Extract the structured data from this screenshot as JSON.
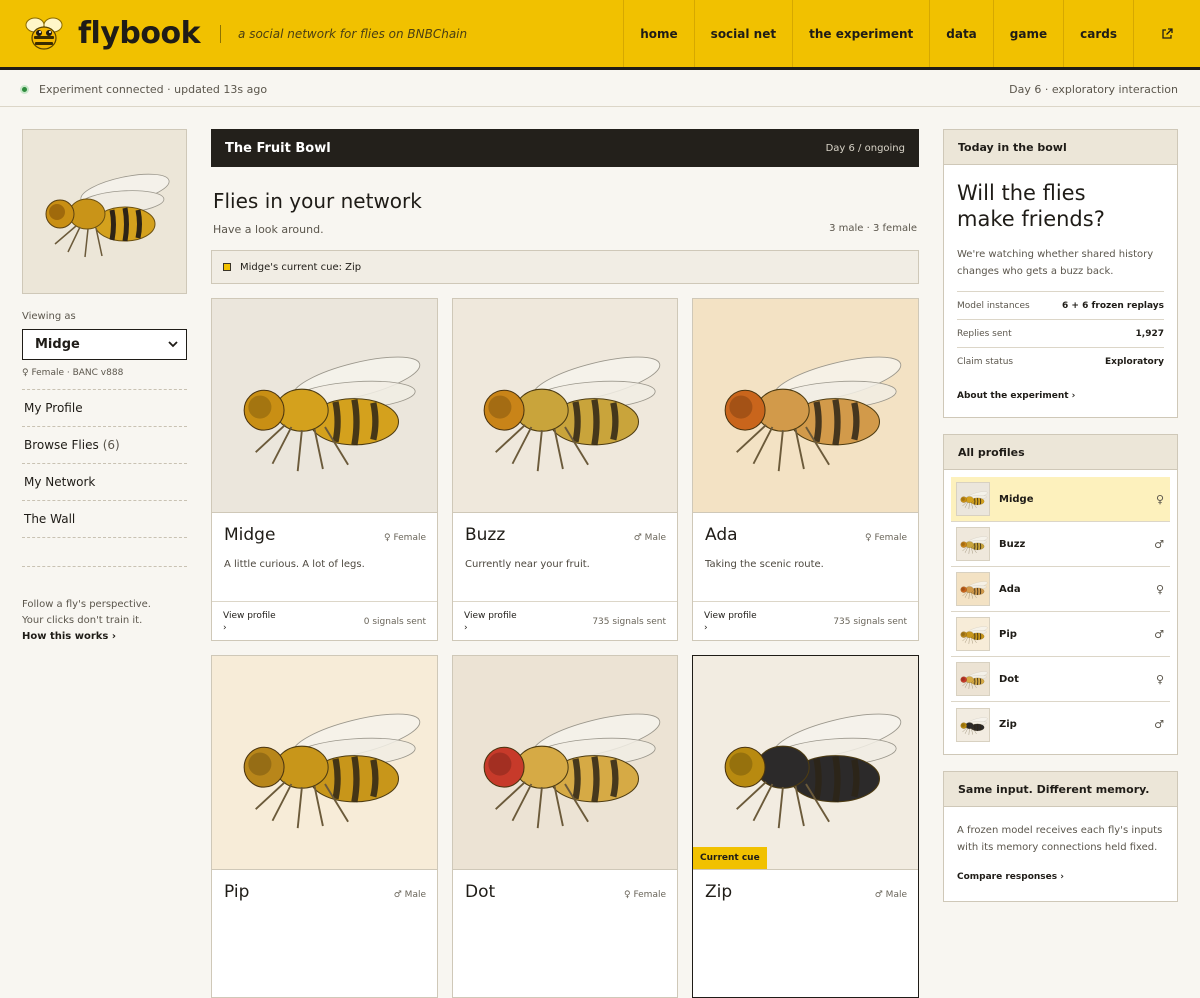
{
  "header": {
    "brand": "flybook",
    "tagline": "a social network for flies on BNBChain",
    "nav": [
      "home",
      "social net",
      "the experiment",
      "data",
      "game",
      "cards"
    ],
    "external_icon": "external-link-icon"
  },
  "status": {
    "left": "Experiment connected · updated 13s ago",
    "right": "Day 6 · exploratory interaction"
  },
  "sidebar": {
    "viewing_label": "Viewing as",
    "selected": "Midge",
    "meta": "♀ Female · BANC v888",
    "links": [
      {
        "label": "My Profile",
        "count": ""
      },
      {
        "label": "Browse Flies",
        "count": "(6)"
      },
      {
        "label": "My Network",
        "count": ""
      },
      {
        "label": "The Wall",
        "count": ""
      }
    ],
    "foot_line1": "Follow a fly's perspective.",
    "foot_line2": "Your clicks don't train it.",
    "how": "How this works ›"
  },
  "main": {
    "bowl_title": "The Fruit Bowl",
    "bowl_day": "Day 6 / ongoing",
    "title": "Flies in your network",
    "subtitle": "Have a look around.",
    "counts": "3 male · 3 female",
    "cue": "Midge's current cue: Zip",
    "cards": [
      {
        "name": "Midge",
        "sex": "♀ Female",
        "desc": "A little curious. A lot of legs.",
        "link": "View profile",
        "signals": "0 signals sent",
        "bg": "#ebe6dc",
        "eye": "#c98f14",
        "body": "#d4a11d"
      },
      {
        "name": "Buzz",
        "sex": "♂ Male",
        "desc": "Currently near your fruit.",
        "link": "View profile",
        "signals": "735 signals sent",
        "bg": "#efe8dc",
        "eye": "#c98418",
        "body": "#c9a43b"
      },
      {
        "name": "Ada",
        "sex": "♀ Female",
        "desc": "Taking the scenic route.",
        "link": "View profile",
        "signals": "735 signals sent",
        "bg": "#f3e2c4",
        "eye": "#c9651c",
        "body": "#d29a4a"
      },
      {
        "name": "Pip",
        "sex": "♂ Male",
        "desc": "",
        "link": "",
        "signals": "",
        "bg": "#f7ecd8",
        "eye": "#b8861a",
        "body": "#c8961a"
      },
      {
        "name": "Dot",
        "sex": "♀ Female",
        "desc": "",
        "link": "",
        "signals": "",
        "bg": "#ece3d4",
        "eye": "#c73a2a",
        "body": "#d6aa45"
      },
      {
        "name": "Zip",
        "sex": "♂ Male",
        "desc": "",
        "link": "",
        "signals": "",
        "bg": "#f2ece1",
        "eye": "#b88a10",
        "body": "#2c2a2a",
        "badge": "Current cue"
      }
    ]
  },
  "right": {
    "today_head": "Today in the bowl",
    "question_1": "Will the flies",
    "question_2": "make friends?",
    "desc": "We're watching whether shared history changes who gets a buzz back.",
    "stats": [
      {
        "label": "Model instances",
        "value": "6 + 6 frozen replays"
      },
      {
        "label": "Replies sent",
        "value": "1,927"
      },
      {
        "label": "Claim status",
        "value": "Exploratory"
      }
    ],
    "about_link": "About the experiment ›",
    "profiles_head": "All profiles",
    "profiles": [
      {
        "name": "Midge",
        "sex": "♀"
      },
      {
        "name": "Buzz",
        "sex": "♂"
      },
      {
        "name": "Ada",
        "sex": "♀"
      },
      {
        "name": "Pip",
        "sex": "♂"
      },
      {
        "name": "Dot",
        "sex": "♀"
      },
      {
        "name": "Zip",
        "sex": "♂"
      }
    ],
    "memory_head": "Same input. Different memory.",
    "memory_desc": "A frozen model receives each fly's inputs with its memory connections held fixed.",
    "compare_link": "Compare responses ›"
  },
  "colors": {
    "accent": "#f1c100",
    "dark": "#23201b",
    "status_green": "#2e8b3d"
  }
}
